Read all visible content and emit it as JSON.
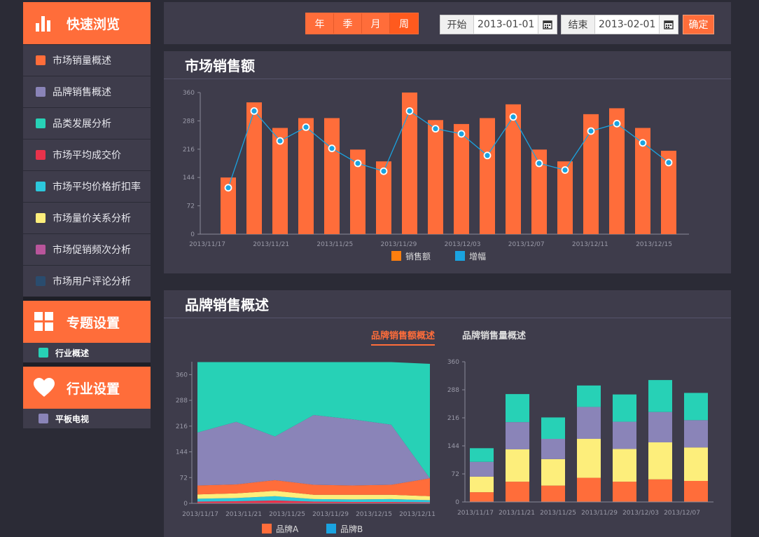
{
  "sidebar": {
    "quick": {
      "title": "快速浏览",
      "items": [
        {
          "label": "市场销量概述",
          "color": "#ff6d3a"
        },
        {
          "label": "品牌销售概述",
          "color": "#8a84b8"
        },
        {
          "label": "品类发展分析",
          "color": "#27d1b6"
        },
        {
          "label": "市场平均成交价",
          "color": "#e8324b"
        },
        {
          "label": "市场平均价格折扣率",
          "color": "#2cc8dc"
        },
        {
          "label": "市场量价关系分析",
          "color": "#fdee7b"
        },
        {
          "label": "市场促销频次分析",
          "color": "#b9559b"
        },
        {
          "label": "市场用户评论分析",
          "color": "#2a4c6e"
        }
      ]
    },
    "topic": {
      "title": "专题设置",
      "items": [
        {
          "label": "行业概述",
          "color": "#27d1b6"
        }
      ]
    },
    "industry": {
      "title": "行业设置",
      "items": [
        {
          "label": "平板电视",
          "color": "#8a84b8"
        }
      ]
    }
  },
  "toolbar": {
    "periods": [
      "年",
      "季",
      "月",
      "周"
    ],
    "active_period": "周",
    "start_label": "开始",
    "start_value": "2013-01-01",
    "end_label": "结束",
    "end_value": "2013-02-01",
    "confirm_label": "确定"
  },
  "panel1": {
    "title": "市场销售额"
  },
  "panel2": {
    "title": "品牌销售概述",
    "tabs": [
      "品牌销售额概述",
      "品牌销售量概述"
    ],
    "active_tab": "品牌销售额概述"
  },
  "chart_data": [
    {
      "type": "bar",
      "title": "市场销售额",
      "ylim": [
        0,
        360
      ],
      "yticks": [
        0,
        72,
        144,
        216,
        288,
        360
      ],
      "x_tick_labels": [
        "2013/11/17",
        "2013/11/21",
        "2013/11/25",
        "2013/11/29",
        "2013/12/03",
        "2013/12/07",
        "2013/12/11",
        "2013/12/15"
      ],
      "series": [
        {
          "name": "销售额",
          "kind": "bar",
          "color": "#ff6d3a",
          "values": [
            144,
            335,
            270,
            295,
            295,
            215,
            185,
            360,
            290,
            280,
            295,
            330,
            215,
            185,
            305,
            320,
            270,
            212
          ]
        },
        {
          "name": "增幅",
          "kind": "line",
          "color": "#1aa3e0",
          "values": [
            118,
            313,
            237,
            272,
            218,
            180,
            160,
            313,
            268,
            255,
            200,
            298,
            180,
            163,
            262,
            281,
            232,
            182
          ]
        }
      ],
      "legend": "bottom"
    },
    {
      "type": "area",
      "ylim": [
        0,
        396
      ],
      "yticks": [
        0,
        72,
        144,
        216,
        288,
        360
      ],
      "x_tick_labels": [
        "2013/11/17",
        "2013/11/21",
        "2013/11/25",
        "2013/11/29",
        "2013/12/15",
        "2013/12/11"
      ],
      "series": [
        {
          "color": "#e8324b",
          "values": [
            5,
            6,
            8,
            5,
            4,
            4,
            3
          ]
        },
        {
          "color": "#2cc8dc",
          "values": [
            8,
            9,
            12,
            7,
            7,
            8,
            6
          ]
        },
        {
          "color": "#fdee7b",
          "values": [
            12,
            13,
            15,
            12,
            13,
            12,
            11
          ]
        },
        {
          "color": "#ff6d3a",
          "values": [
            25,
            25,
            30,
            28,
            26,
            28,
            50
          ]
        },
        {
          "color": "#8a84b8",
          "values": [
            148,
            175,
            122,
            195,
            185,
            168,
            0
          ]
        },
        {
          "color": "#27d1b6",
          "values": [
            197,
            167,
            208,
            148,
            160,
            175,
            320
          ]
        }
      ],
      "legend_entries": [
        {
          "name": "品牌A",
          "color": "#ff6d3a"
        },
        {
          "name": "品牌B",
          "color": "#1aa3e0"
        }
      ]
    },
    {
      "type": "bar",
      "stacked": true,
      "ylim": [
        0,
        360
      ],
      "yticks": [
        0,
        72,
        144,
        216,
        288,
        360
      ],
      "categories": [
        "2013/11/17",
        "2013/11/21",
        "2013/11/25",
        "2013/11/29",
        "2013/12/03",
        "2013/12/07"
      ],
      "series": [
        {
          "color": "#ff6d3a",
          "values": [
            25,
            52,
            42,
            62,
            52,
            58,
            54
          ]
        },
        {
          "color": "#fdee7b",
          "values": [
            40,
            83,
            68,
            100,
            84,
            95,
            86
          ]
        },
        {
          "color": "#8a84b8",
          "values": [
            38,
            70,
            52,
            82,
            70,
            78,
            70
          ]
        },
        {
          "color": "#27d1b6",
          "values": [
            35,
            72,
            55,
            55,
            70,
            82,
            70
          ]
        }
      ]
    }
  ]
}
